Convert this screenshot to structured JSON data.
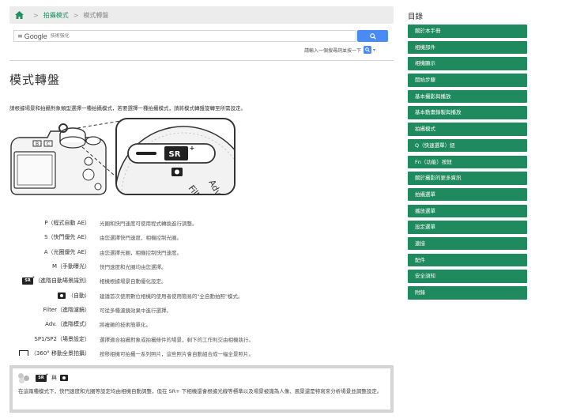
{
  "breadcrumb": {
    "items": [
      "拍攝模式",
      "模式轉盤"
    ]
  },
  "search": {
    "brand": "Google",
    "placeholder": "技術強化",
    "hint": "請輸入一個搜尋詞並按一下"
  },
  "page": {
    "title": "模式轉盤",
    "intro": "請根據場景和拍攝對象類型選擇一種拍攝模式，若要選擇一種拍攝模式，請將模式轉盤旋轉至所需設定。"
  },
  "illustration": {
    "dial_labels": [
      "SR+",
      "Filter",
      "Adv."
    ]
  },
  "modes": [
    {
      "label": "P（程式自動 AE）",
      "desc": "光圈和快門速度可使用程式轉換進行調整。"
    },
    {
      "label": "S（快門優先 AE）",
      "desc": "由您選擇快門速度，相機控制光圈。"
    },
    {
      "label": "A（光圈優先 AE）",
      "desc": "由您選擇光圈，相機控制快門速度。"
    },
    {
      "label": "M（手動曝光）",
      "desc": "快門速度和光圈均由您選擇。"
    },
    {
      "label": "（進階自動場景識別）",
      "desc": "相機根據場景自動優化設定。"
    },
    {
      "label": "（自動）",
      "desc": "建議首次使用數位相機的使用者使用簡易的\"全自動拍照\"模式。"
    },
    {
      "label": "Filter（進階濾鏡）",
      "desc": "可從多種濾鏡效果中進行選擇。"
    },
    {
      "label": "Adv.（進階模式）",
      "desc": "將複雜的技術簡單化。"
    },
    {
      "label": "SP1/SP2（場景設定）",
      "desc": "選擇適合拍攝對象或拍攝條件的場景，剩下的工作則交由相機執行。"
    },
    {
      "label": "（360° 移動全景拍攝）",
      "desc": "按移相機可拍攝一系列照片，這些照片會自動組合成一幅全景照片。"
    }
  ],
  "note": {
    "badge_text": "SR+",
    "connector": "與",
    "text": "在這兩種模式下，快門速度和光圈等設定均由相機自動調整，但在 SR+ 下相機還會根據光線等標準以及場景被識為人像、風景還是特寫來分析場景並調整設定。"
  },
  "sidebar": {
    "title": "目錄",
    "items": [
      "關於本手冊",
      "相機部件",
      "相機顯示",
      "開始步驟",
      "基本攝影與播放",
      "基本動畫錄製與播放",
      "拍攝模式",
      "Q（快速選單）鈕",
      "Fn（功能）按鈕",
      "關於攝影的更多資訊",
      "拍攝選單",
      "播放選單",
      "設定選單",
      "連接",
      "配件",
      "安全須知",
      "附錄"
    ]
  },
  "colors": {
    "accent": "#1f8a5e",
    "search_button": "#4a8af4",
    "breadcrumb_bg": "#ececec"
  }
}
